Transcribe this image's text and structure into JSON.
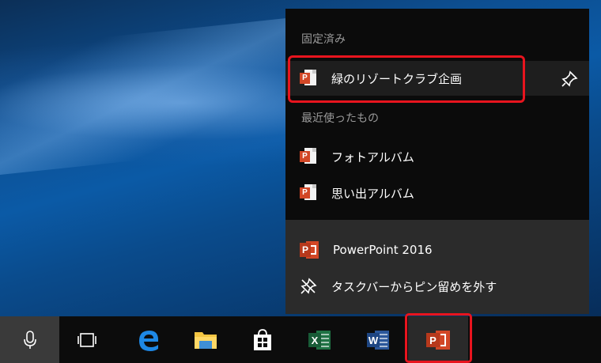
{
  "jumplist": {
    "pinned_title": "固定済み",
    "pinned_items": [
      {
        "label": "緑のリゾートクラブ企画",
        "icon": "powerpoint-file-icon"
      }
    ],
    "recent_title": "最近使ったもの",
    "recent_items": [
      {
        "label": "フォトアルバム",
        "icon": "powerpoint-file-icon"
      },
      {
        "label": "思い出アルバム",
        "icon": "powerpoint-file-icon"
      }
    ],
    "tasks": [
      {
        "label": "PowerPoint 2016",
        "icon": "powerpoint-app-icon"
      },
      {
        "label": "タスクバーからピン留めを外す",
        "icon": "unpin-icon"
      }
    ],
    "pin_tooltip_icon": "pin-icon"
  },
  "taskbar": {
    "buttons": [
      {
        "name": "cortana-mic",
        "icon": "microphone-icon"
      },
      {
        "name": "task-view",
        "icon": "task-view-icon"
      },
      {
        "name": "edge",
        "icon": "edge-icon"
      },
      {
        "name": "file-explorer",
        "icon": "folder-icon"
      },
      {
        "name": "store",
        "icon": "store-icon"
      },
      {
        "name": "excel",
        "icon": "excel-icon"
      },
      {
        "name": "word",
        "icon": "word-icon"
      },
      {
        "name": "powerpoint",
        "icon": "powerpoint-icon",
        "active": true
      }
    ]
  },
  "colors": {
    "highlight": "#e8141e",
    "powerpoint": "#d24726",
    "excel": "#1f7244",
    "word": "#2b579a",
    "edge": "#1e88e5",
    "active_underline": "#8fb9e4"
  }
}
